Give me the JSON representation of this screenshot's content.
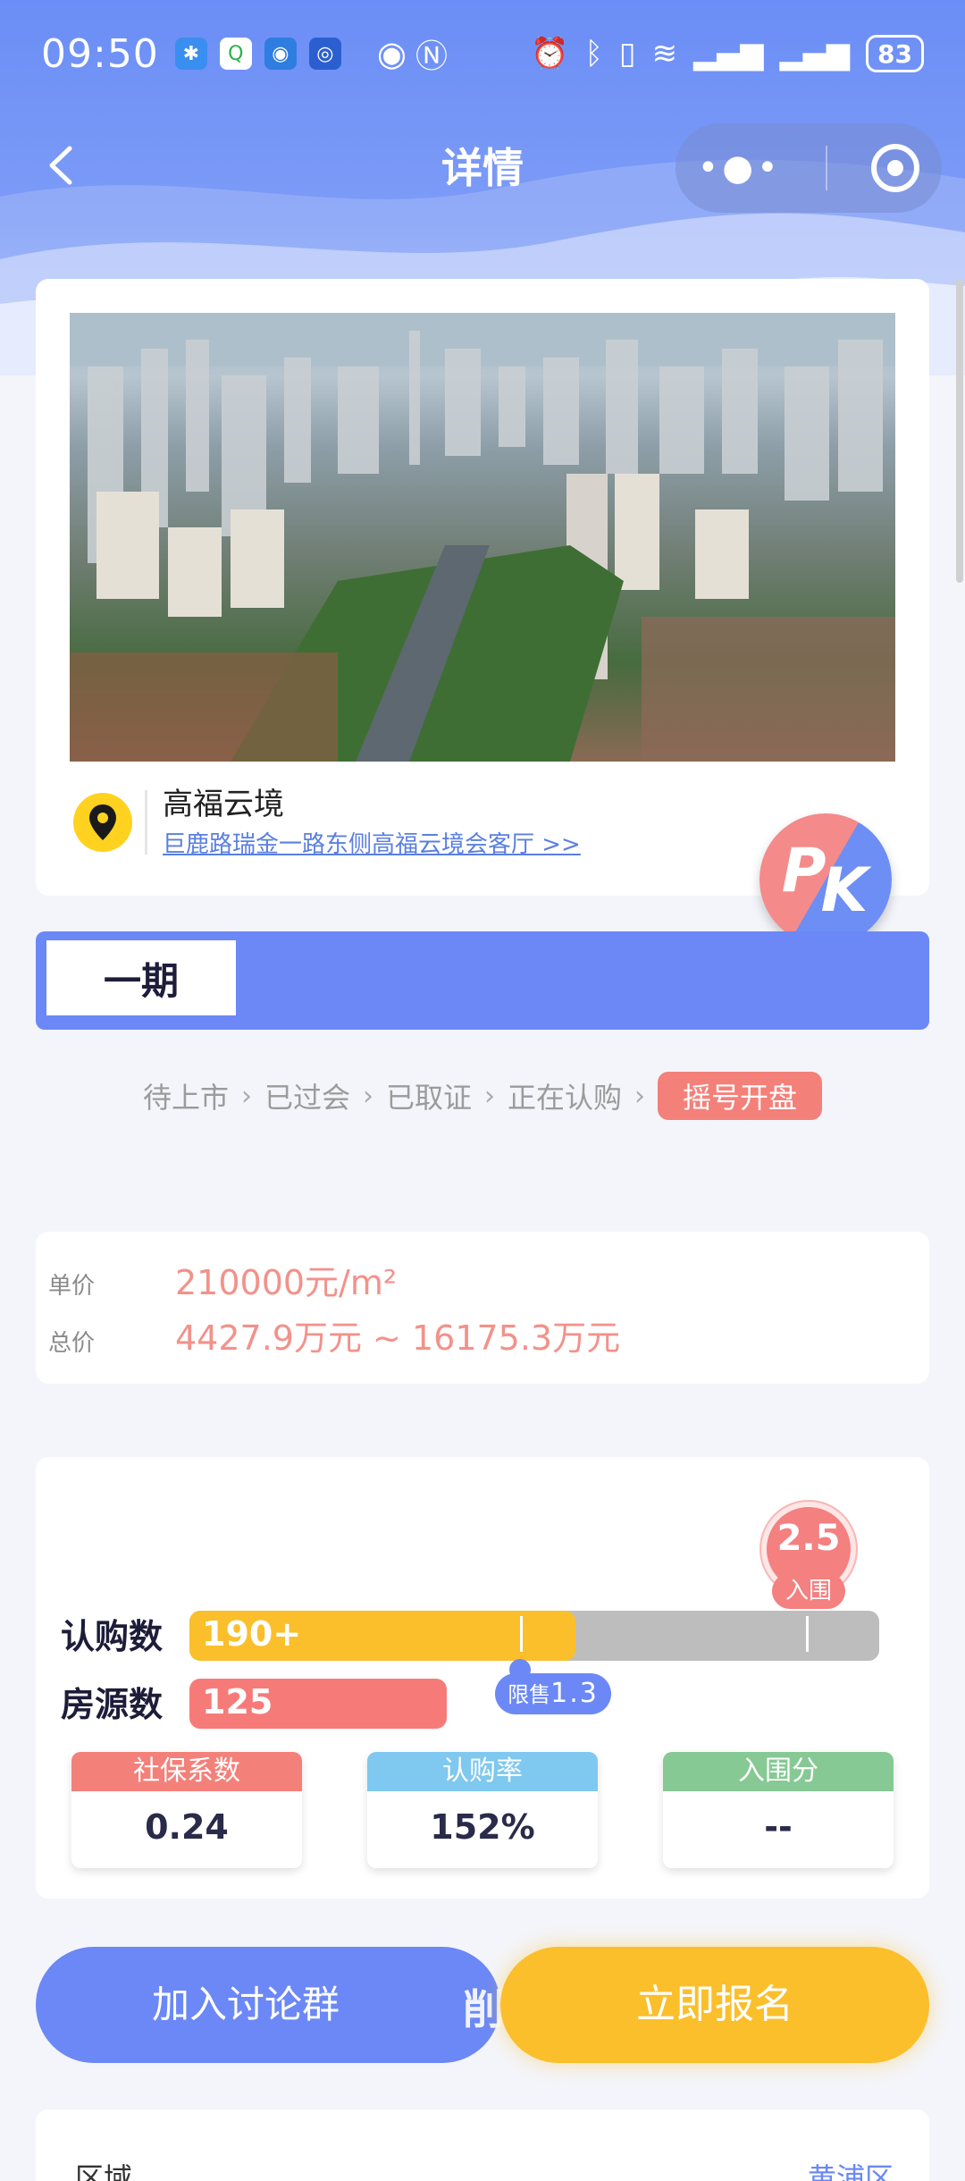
{
  "status_bar": {
    "time": "09:50",
    "battery": "83",
    "apps": [
      "app-icon-1",
      "app-icon-2",
      "app-icon-3",
      "app-icon-4"
    ]
  },
  "nav": {
    "title": "详情"
  },
  "project": {
    "name": "高福云境",
    "address": "巨鹿路瑞金一路东侧高福云境会客厅 >>"
  },
  "pk": {
    "p": "P",
    "k": "K"
  },
  "phase": {
    "label": "一期"
  },
  "steps": [
    {
      "label": "待上市"
    },
    {
      "label": "已过会"
    },
    {
      "label": "已取证"
    },
    {
      "label": "正在认购"
    },
    {
      "label": "摇号开盘"
    }
  ],
  "price": {
    "unit_label": "单价",
    "unit_value": "210000元/m²",
    "total_label": "总价",
    "total_value": "4427.9万元 ~ 16175.3万元"
  },
  "stats": {
    "bubble_value": "2.5",
    "bubble_tag": "入围",
    "subscriptions_label": "认购数",
    "subscriptions_value": "190+",
    "subscriptions_fill": 0.56,
    "listings_label": "房源数",
    "listings_value": "125",
    "limit_label": "限售",
    "limit_value": "1.3",
    "metrics": [
      {
        "label": "社保系数",
        "value": "0.24",
        "color": "#f4807a"
      },
      {
        "label": "认购率",
        "value": "152%",
        "color": "#7fc8ef"
      },
      {
        "label": "入围分",
        "value": "--",
        "color": "#86c994"
      }
    ]
  },
  "actions": {
    "join_label": "加入讨论群",
    "ghost_label": "削",
    "signup_label": "立即报名"
  },
  "details": {
    "area_label": "区域",
    "area_value": "黄浦区"
  }
}
